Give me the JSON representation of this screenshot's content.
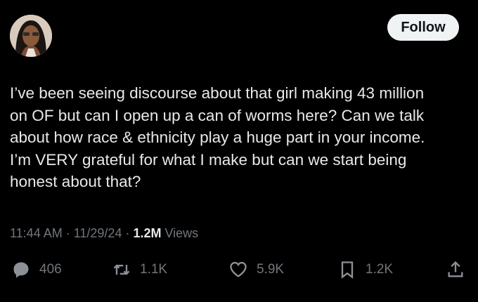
{
  "header": {
    "follow_label": "Follow"
  },
  "tweet": {
    "text": "I’ve been seeing discourse about that girl making 43 million\non OF but can I open up a can of worms here? Can we talk\nabout how race & ethnicity play a huge part in your income.\nI’m VERY grateful for what I make but can we start being\nhonest about that?"
  },
  "meta": {
    "time": "11:44 AM",
    "separator": "·",
    "date": "11/29/24",
    "views_count": "1.2M",
    "views_label": "Views"
  },
  "actions": {
    "replies": "406",
    "reposts": "1.1K",
    "likes": "5.9K",
    "bookmarks": "1.2K"
  },
  "colors": {
    "background": "#000000",
    "text": "#e7e9ea",
    "muted": "#71767b",
    "button": "#eff3f4"
  },
  "icons": [
    "reply-icon",
    "repost-icon",
    "like-icon",
    "bookmark-icon",
    "share-icon"
  ]
}
